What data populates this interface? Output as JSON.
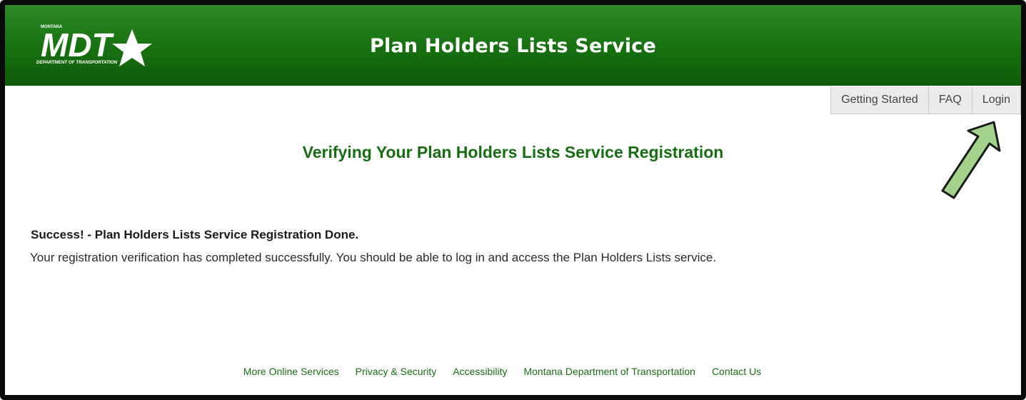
{
  "header": {
    "logo_small_text": "MONTANA",
    "logo_main_text": "MDT",
    "logo_sub_text": "DEPARTMENT OF TRANSPORTATION",
    "title": "Plan Holders Lists Service"
  },
  "nav": {
    "items": [
      {
        "label": "Getting Started"
      },
      {
        "label": "FAQ"
      },
      {
        "label": "Login"
      }
    ]
  },
  "main": {
    "heading": "Verifying Your Plan Holders Lists Service Registration",
    "success_title": "Success! - Plan Holders Lists Service Registration Done.",
    "success_message": "Your registration verification has completed successfully. You should be able to log in and access the Plan Holders Lists service."
  },
  "footer": {
    "links": [
      {
        "label": "More Online Services"
      },
      {
        "label": "Privacy & Security"
      },
      {
        "label": "Accessibility"
      },
      {
        "label": "Montana Department of Transportation"
      },
      {
        "label": "Contact Us"
      }
    ]
  },
  "colors": {
    "header_green": "#16700f",
    "heading_green": "#176e12",
    "arrow_fill": "#a3d28a"
  },
  "icons": {
    "annotation": "arrow-up-right-icon"
  }
}
